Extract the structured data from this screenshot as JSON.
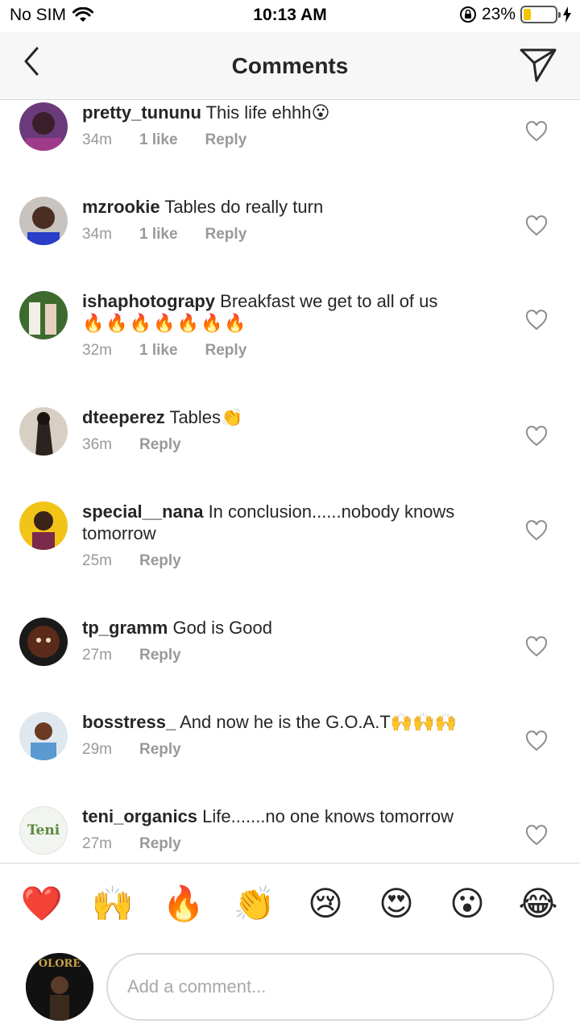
{
  "status": {
    "carrier": "No SIM",
    "time": "10:13 AM",
    "battery": "23%",
    "battery_level": 0.23
  },
  "header": {
    "title": "Comments"
  },
  "comments": [
    {
      "user": "pretty_tununu",
      "text": "This life ehhh😮",
      "time": "34m",
      "likes": "1 like",
      "reply": "Reply"
    },
    {
      "user": "mzrookie",
      "text": "Tables do really turn",
      "time": "34m",
      "likes": "1 like",
      "reply": "Reply"
    },
    {
      "user": "ishaphotograpy",
      "text": "Breakfast we get to all of us",
      "extra": "🔥🔥🔥🔥🔥🔥🔥",
      "time": "32m",
      "likes": "1 like",
      "reply": "Reply"
    },
    {
      "user": "dteeperez",
      "text": "Tables👏",
      "time": "36m",
      "reply": "Reply"
    },
    {
      "user": "special__nana",
      "text": "In conclusion......nobody knows tomorrow",
      "time": "25m",
      "reply": "Reply"
    },
    {
      "user": "tp_gramm",
      "text": "God is Good",
      "time": "27m",
      "reply": "Reply"
    },
    {
      "user": "bosstress_",
      "text": "And now he is the G.O.A.T🙌🙌🙌",
      "time": "29m",
      "reply": "Reply"
    },
    {
      "user": "teni_organics",
      "text": "Life.......no one knows tomorrow",
      "time": "27m",
      "reply": "Reply",
      "avatar_text": "Teni"
    }
  ],
  "reactions": [
    "❤️",
    "🙌",
    "🔥",
    "👏",
    "😢",
    "😍",
    "😮",
    "😂"
  ],
  "composer": {
    "placeholder": "Add a comment...",
    "avatar_text": "OLORE"
  },
  "colors": {
    "text": "#262626",
    "meta": "#999999",
    "divider": "#d9d9d9",
    "battery": "#f5c400"
  }
}
